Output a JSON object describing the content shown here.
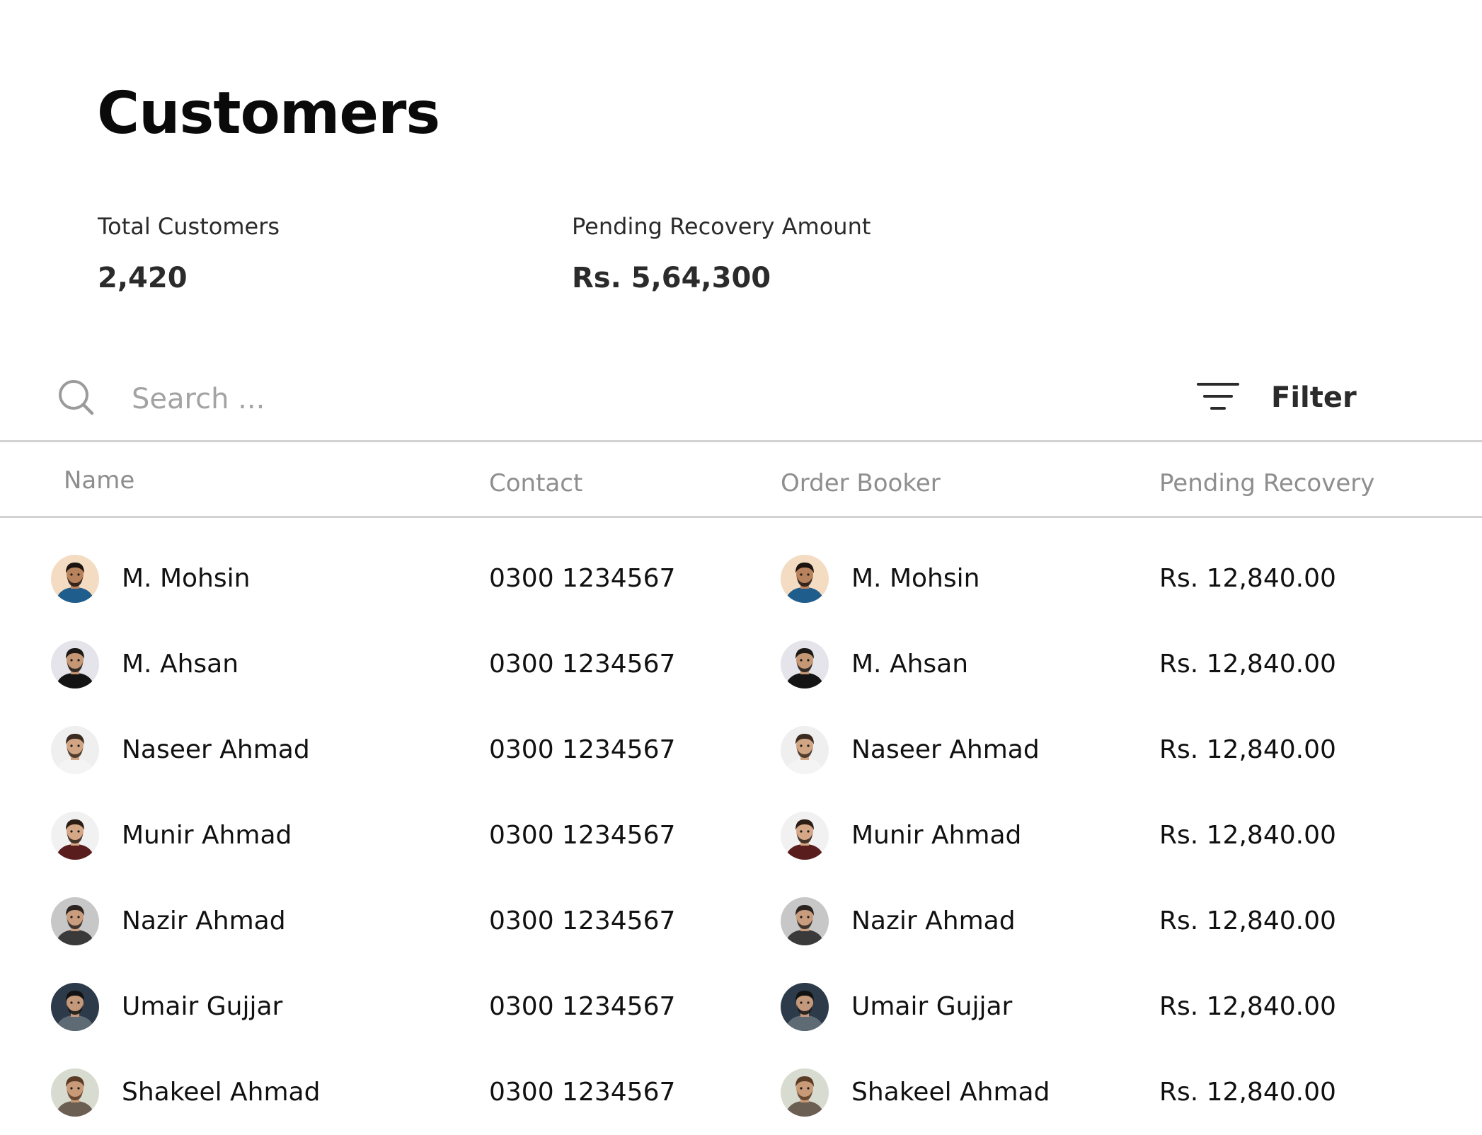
{
  "page": {
    "title": "Customers"
  },
  "stats": {
    "total_customers_label": "Total Customers",
    "total_customers_value": "2,420",
    "pending_recovery_label": "Pending Recovery Amount",
    "pending_recovery_value": "Rs.  5,64,300"
  },
  "search": {
    "placeholder": "Search ...",
    "value": "",
    "icon": "search-icon"
  },
  "filter": {
    "label": "Filter",
    "icon": "filter-icon"
  },
  "table": {
    "columns": [
      "Name",
      "Contact",
      "Order Booker",
      "Pending Recovery"
    ],
    "rows": [
      {
        "name": "M. Mohsin",
        "contact": "0300 1234567",
        "booker": "M. Mohsin",
        "pending": "Rs. 12,840.00",
        "avatar": {
          "bg": "#f3dcc2",
          "skin": "#b8825c",
          "hair": "#1c1410",
          "shirt": "#1f5d8c"
        }
      },
      {
        "name": "M. Ahsan",
        "contact": "0300 1234567",
        "booker": "M. Ahsan",
        "pending": "Rs. 12,840.00",
        "avatar": {
          "bg": "#e4e4ea",
          "skin": "#c59774",
          "hair": "#1b1815",
          "shirt": "#141414"
        }
      },
      {
        "name": "Naseer Ahmad",
        "contact": "0300 1234567",
        "booker": "Naseer Ahmad",
        "pending": "Rs. 12,840.00",
        "avatar": {
          "bg": "#efefef",
          "skin": "#d1a583",
          "hair": "#3b2a20",
          "shirt": "#f4f4f4"
        }
      },
      {
        "name": "Munir Ahmad",
        "contact": "0300 1234567",
        "booker": "Munir Ahmad",
        "pending": "Rs. 12,840.00",
        "avatar": {
          "bg": "#f1f1f1",
          "skin": "#d6a787",
          "hair": "#2b1d16",
          "shirt": "#5a1d1d"
        }
      },
      {
        "name": "Nazir Ahmad",
        "contact": "0300 1234567",
        "booker": "Nazir Ahmad",
        "pending": "Rs. 12,840.00",
        "avatar": {
          "bg": "#c7c7c7",
          "skin": "#c99c7e",
          "hair": "#2a2320",
          "shirt": "#3a3a3a"
        }
      },
      {
        "name": "Umair Gujjar",
        "contact": "0300 1234567",
        "booker": "Umair Gujjar",
        "pending": "Rs. 12,840.00",
        "avatar": {
          "bg": "#2c3a4a",
          "skin": "#c4987b",
          "hair": "#121212",
          "shirt": "#5e6b75"
        }
      },
      {
        "name": "Shakeel Ahmad",
        "contact": "0300 1234567",
        "booker": "Shakeel Ahmad",
        "pending": "Rs. 12,840.00",
        "avatar": {
          "bg": "#d8dbcf",
          "skin": "#c99a78",
          "hair": "#5a3b25",
          "shirt": "#6b5e52"
        }
      }
    ]
  }
}
